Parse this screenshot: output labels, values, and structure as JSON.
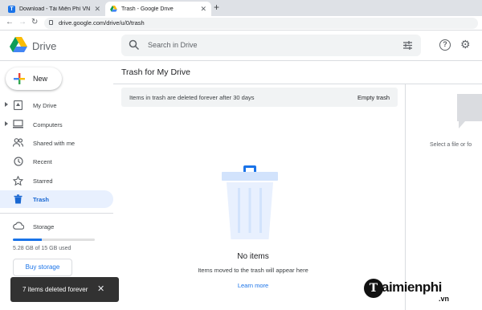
{
  "browser": {
    "tabs": [
      {
        "title": "Download - Tải Miễn Phí VN - Ph",
        "favicon": "T"
      },
      {
        "title": "Trash - Google Drive"
      }
    ],
    "url": "drive.google.com/drive/u/0/trash"
  },
  "header": {
    "brand": "Drive",
    "search_placeholder": "Search in Drive"
  },
  "sidebar": {
    "new_label": "New",
    "items": [
      {
        "label": "My Drive",
        "icon": "my-drive-icon",
        "expandable": true
      },
      {
        "label": "Computers",
        "icon": "computers-icon",
        "expandable": true
      },
      {
        "label": "Shared with me",
        "icon": "shared-icon",
        "expandable": false
      },
      {
        "label": "Recent",
        "icon": "clock-icon",
        "expandable": false
      },
      {
        "label": "Starred",
        "icon": "star-icon",
        "expandable": false
      },
      {
        "label": "Trash",
        "icon": "trash-icon",
        "expandable": false,
        "active": true
      }
    ],
    "storage_label": "Storage",
    "storage_usage": "5.28 GB of 15 GB used",
    "storage_fraction": 0.352,
    "buy_storage": "Buy storage"
  },
  "main": {
    "title": "Trash for My Drive",
    "banner_msg": "Items in trash are deleted forever after 30 days",
    "empty_trash": "Empty trash",
    "empty_title": "No items",
    "empty_msg": "Items moved to the trash will appear here",
    "learn_more": "Learn more"
  },
  "details": {
    "hint": "Select a file or fo"
  },
  "snackbar": {
    "message": "7 items deleted forever"
  },
  "watermark": {
    "text": "aimienphi",
    "suffix": ".vn",
    "letter": "T"
  },
  "colors": {
    "accent": "#1a73e8",
    "active_bg": "#e8f0fe",
    "snackbar_bg": "#323232"
  }
}
